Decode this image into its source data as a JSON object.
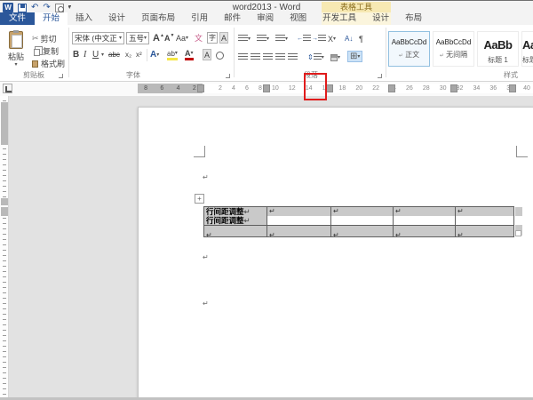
{
  "titlebar": {
    "title": "word2013 - Word",
    "contextual_title": "表格工具"
  },
  "tabs": {
    "file": "文件",
    "items": [
      "开始",
      "插入",
      "设计",
      "页面布局",
      "引用",
      "邮件",
      "审阅",
      "视图",
      "开发工具"
    ],
    "contextual": [
      "设计",
      "布局"
    ]
  },
  "ribbon": {
    "clipboard": {
      "label": "剪贴板",
      "paste": "粘贴",
      "cut": "剪切",
      "copy": "复制",
      "format_painter": "格式刷"
    },
    "font": {
      "label": "字体",
      "name": "宋体 (中文正",
      "size": "五号",
      "grow": "A",
      "shrink": "A",
      "change_case": "Aa",
      "phonetic": "文",
      "char_border": "字",
      "char_shading": "A",
      "bold": "B",
      "italic": "I",
      "underline": "U",
      "strikethrough": "abc",
      "subscript": "x₂",
      "superscript": "x²",
      "text_effects": "A",
      "highlight": "ab",
      "font_color": "A",
      "enclose": "Ⓐ"
    },
    "paragraph": {
      "label": "段落",
      "cjk_layout": "X",
      "sort": "A↓",
      "show_marks": "¶",
      "line_spacing": "⇕",
      "borders_grid": "⊞"
    },
    "styles": {
      "label": "样式",
      "items": [
        {
          "sample": "AaBbCcDd",
          "name": "正文"
        },
        {
          "sample": "AaBbCcDd",
          "name": "无间隔"
        },
        {
          "sample": "AaBb",
          "name": "标题 1"
        },
        {
          "sample": "AaB",
          "name": "标题"
        }
      ]
    }
  },
  "ruler": {
    "margin_numbers": [
      "8",
      "6",
      "4",
      "2"
    ],
    "numbers": [
      "2",
      "4",
      "6",
      "8",
      "10",
      "12",
      "14",
      "16",
      "18",
      "20",
      "22",
      "24",
      "26",
      "28",
      "30",
      "32",
      "34",
      "36",
      "38",
      "40"
    ]
  },
  "doc": {
    "pilcrow": "↵",
    "table_text": "行间距调整"
  },
  "icons": {
    "undo": "↶",
    "redo": "↷",
    "caret": "▾",
    "scissors": "✂",
    "plus": "+"
  },
  "colors": {
    "accent_blue": "#2b579a",
    "contextual_yellow": "#f7e9b3",
    "red_box": "#e01b1b",
    "selection_gray": "#c9c9c9"
  }
}
